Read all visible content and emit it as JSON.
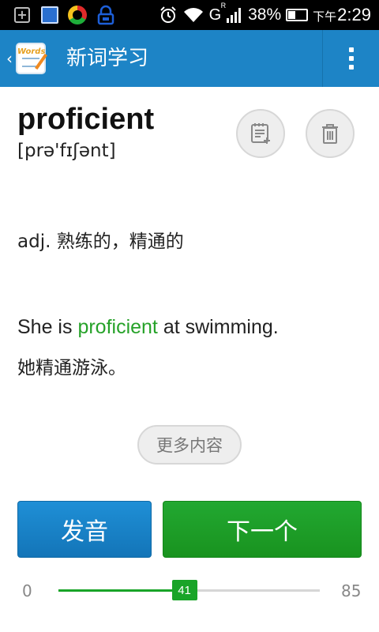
{
  "status_bar": {
    "network": "G",
    "network_sup": "R",
    "battery": "38%",
    "time_prefix": "下午",
    "time": "2:29"
  },
  "app_bar": {
    "title": "新词学习",
    "logo_text": "Words"
  },
  "word": {
    "text": "proficient",
    "phonetic": "[prə'fɪʃənt]"
  },
  "definition": "adj. 熟练的，精通的",
  "example": {
    "en_before": "She is ",
    "en_highlight": "proficient",
    "en_after": " at swimming.",
    "zh": "她精通游泳。"
  },
  "more_label": "更多内容",
  "buttons": {
    "pronounce": "发音",
    "next": "下一个"
  },
  "progress": {
    "min": "0",
    "max": "85",
    "value": "41",
    "fraction": 0.482
  },
  "colors": {
    "app_bar": "#1d84c6",
    "accent_green": "#19a428",
    "highlight": "#26a229"
  },
  "icons": {
    "add_note": "note-add-icon",
    "delete": "trash-icon",
    "overflow": "overflow-menu-icon",
    "back": "chevron-left-icon"
  }
}
